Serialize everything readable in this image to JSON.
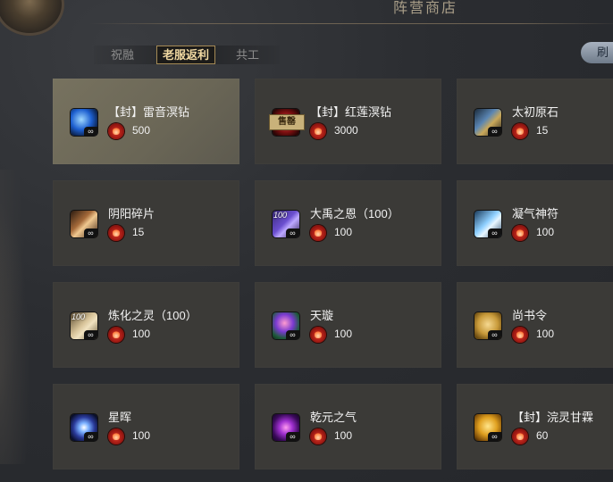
{
  "header": {
    "shop_title": "阵营商店"
  },
  "tabs": [
    {
      "label": "祝融",
      "active": false
    },
    {
      "label": "老服返利",
      "active": true
    },
    {
      "label": "共工",
      "active": false
    }
  ],
  "refresh_label": "刷",
  "currency_icon": "flame-coin-icon",
  "infinity_mark": "∞",
  "items": [
    {
      "name": "【封】雷音溟钻",
      "price": "500",
      "icon": "thunder-gem-icon",
      "selected": true
    },
    {
      "name": "【封】红莲溟钻",
      "price": "3000",
      "icon": "red-lotus-gem-icon",
      "sold_label": "售罄"
    },
    {
      "name": "太初原石",
      "price": "15",
      "icon": "primordial-stone-icon"
    },
    {
      "name": "阴阳碎片",
      "price": "15",
      "icon": "yin-yang-shard-icon"
    },
    {
      "name": "大禹之恩（100）",
      "price": "100",
      "icon": "dayu-grace-icon",
      "badge": "100"
    },
    {
      "name": "凝气神符",
      "price": "100",
      "icon": "qi-rune-icon"
    },
    {
      "name": "炼化之灵（100）",
      "price": "100",
      "icon": "refining-spirit-icon",
      "badge": "100"
    },
    {
      "name": "天璇",
      "price": "100",
      "icon": "tianxuan-jade-icon"
    },
    {
      "name": "尚书令",
      "price": "100",
      "icon": "minister-order-icon"
    },
    {
      "name": "星晖",
      "price": "100",
      "icon": "star-radiance-icon"
    },
    {
      "name": "乾元之气",
      "price": "100",
      "icon": "qianyuan-qi-icon"
    },
    {
      "name": "【封】浣灵甘霖",
      "price": "60",
      "icon": "spirit-dew-icon"
    }
  ]
}
